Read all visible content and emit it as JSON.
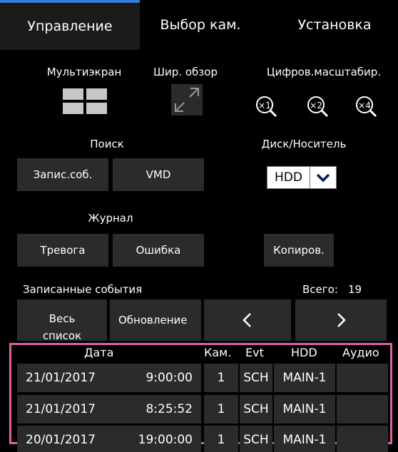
{
  "tabs": [
    {
      "label": "Управление",
      "active": true
    },
    {
      "label": "Выбор кам.",
      "active": false
    },
    {
      "label": "Установка",
      "active": false
    }
  ],
  "view": {
    "multiscreen_label": "Мультиэкран",
    "wide_label": "Шир. обзор",
    "zoom_label": "Цифров.масштабир.",
    "multiscreen_icon": "quad-grid-icon",
    "wide_icon": "expand-arrows-icon",
    "zoom_levels": [
      "×1",
      "×2",
      "×4"
    ]
  },
  "search": {
    "label": "Поиск",
    "rec_event_button": "Запис.соб.",
    "vmd_button": "VMD"
  },
  "disk": {
    "label": "Диск/Носитель",
    "selected": "HDD"
  },
  "journal": {
    "label": "Журнал",
    "alarm_button": "Тревога",
    "error_button": "Ошибка"
  },
  "copy_button": "Копиров.",
  "events": {
    "label": "Записанные события",
    "total_label": "Всего:",
    "total_value": "19",
    "all_list_button": "Весь список",
    "refresh_button": "Обновление",
    "prev_glyph": "‹",
    "next_glyph": "›"
  },
  "table": {
    "headers": [
      "Дата",
      "Кам.",
      "Evt",
      "HDD",
      "Аудио"
    ],
    "rows": [
      {
        "date": "21/01/2017",
        "time": "9:00:00",
        "cam": "1",
        "evt": "SCH",
        "hdd": "MAIN-1",
        "audio": ""
      },
      {
        "date": "21/01/2017",
        "time": "8:25:52",
        "cam": "1",
        "evt": "SCH",
        "hdd": "MAIN-1",
        "audio": ""
      },
      {
        "date": "20/01/2017",
        "time": "19:00:00",
        "cam": "1",
        "evt": "SCH",
        "hdd": "MAIN-1",
        "audio": ""
      }
    ]
  },
  "colors": {
    "background": "#000000",
    "button": "#2b2b2b",
    "active_tab": "#1b1b1b",
    "tab_accent": "#2f7fd6",
    "highlight_border": "#e060a0"
  }
}
